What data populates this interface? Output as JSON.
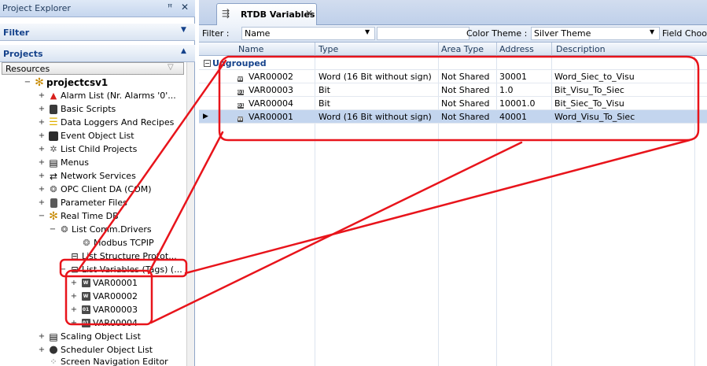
{
  "project_explorer": {
    "title": "Project Explorer",
    "pin_icon": "pin-icon",
    "close_icon": "close-icon",
    "filter_label": "Filter",
    "projects_label": "Projects",
    "resources_label": "Resources",
    "tree": [
      {
        "label": "projectcsv1",
        "icon": "gear-icon",
        "exp": "−"
      },
      {
        "label": "Alarm List (Nr. Alarms '0'...",
        "icon": "alarm-bell-icon",
        "exp": "+"
      },
      {
        "label": "Basic Scripts",
        "icon": "script-icon",
        "exp": "+"
      },
      {
        "label": "Data Loggers And Recipes",
        "icon": "database-icon",
        "exp": "+"
      },
      {
        "label": "Event Object List",
        "icon": "event-icon",
        "exp": "+"
      },
      {
        "label": "List Child Projects",
        "icon": "child-projects-icon",
        "exp": "+"
      },
      {
        "label": "Menus",
        "icon": "menu-icon",
        "exp": "+"
      },
      {
        "label": "Network Services",
        "icon": "network-icon",
        "exp": "+"
      },
      {
        "label": "OPC Client DA (COM)",
        "icon": "opc-icon",
        "exp": "+"
      },
      {
        "label": "Parameter Files",
        "icon": "file-icon",
        "exp": "+"
      },
      {
        "label": "Real Time DB",
        "icon": "gear-icon",
        "exp": "−"
      },
      {
        "label": "List Comm.Drivers",
        "icon": "driver-icon",
        "exp": "−"
      },
      {
        "label": "Modbus TCPIP",
        "icon": "driver-icon",
        "exp": ""
      },
      {
        "label": "List Structure Protot...",
        "icon": "structure-icon",
        "exp": ""
      },
      {
        "label": "List Variables (Tags) (...",
        "icon": "variables-icon",
        "exp": "−"
      },
      {
        "label": "VAR00001",
        "icon": "word-var-icon",
        "exp": "+"
      },
      {
        "label": "VAR00002",
        "icon": "word-var-icon",
        "exp": "+"
      },
      {
        "label": "VAR00003",
        "icon": "bit-var-icon",
        "exp": "+"
      },
      {
        "label": "VAR00004",
        "icon": "bit-var-icon",
        "exp": "+"
      },
      {
        "label": "Scaling Object List",
        "icon": "scaling-icon",
        "exp": "+"
      },
      {
        "label": "Scheduler Object List",
        "icon": "scheduler-icon",
        "exp": "+"
      },
      {
        "label": "Screen Navigation Editor",
        "icon": "navigation-icon",
        "exp": ""
      }
    ]
  },
  "editor": {
    "tab_label": "RTDB Variables",
    "tab_icon": "rtdb-icon",
    "filter_label": "Filter :",
    "filter_field_value": "Name",
    "filter_text_value": "",
    "color_theme_label": "Color Theme :",
    "color_theme_value": "Silver Theme",
    "field_chooser_label": "Field Choo",
    "columns": [
      "Name",
      "Type",
      "Area Type",
      "Address",
      "Description"
    ],
    "group_label": "Ungrouped",
    "rows": [
      {
        "name": "VAR00002",
        "type": "Word (16 Bit without sign)",
        "area": "Not Shared",
        "address": "30001",
        "description": "Word_Siec_to_Visu",
        "icon": "W"
      },
      {
        "name": "VAR00003",
        "type": "Bit",
        "area": "Not Shared",
        "address": "1.0",
        "description": "Bit_Visu_To_Siec",
        "icon": "01"
      },
      {
        "name": "VAR00004",
        "type": "Bit",
        "area": "Not Shared",
        "address": "10001.0",
        "description": "Bit_Siec_To_Visu",
        "icon": "01"
      },
      {
        "name": "VAR00001",
        "type": "Word (16 Bit without sign)",
        "area": "Not Shared",
        "address": "40001",
        "description": "Word_Visu_To_Siec",
        "icon": "W"
      }
    ]
  },
  "colors": {
    "annotation_red": "#e8141b",
    "selection": "#c3d5ee",
    "header_blue": "#15428b"
  }
}
